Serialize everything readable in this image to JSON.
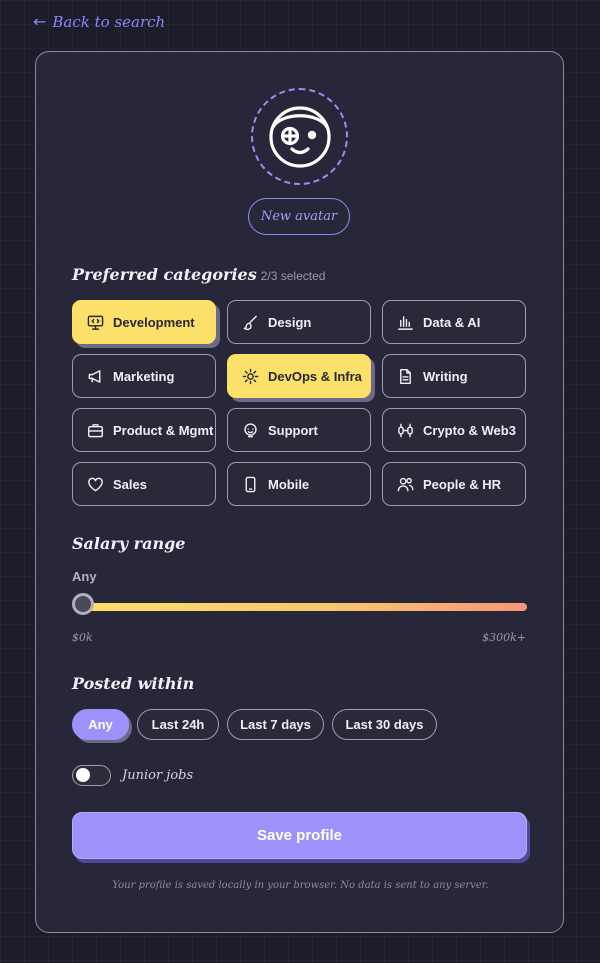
{
  "nav": {
    "back_arrow": "←",
    "back_label": "Back to search"
  },
  "avatar": {
    "icon": "face-with-headband-icon",
    "button_label": "New avatar"
  },
  "categories": {
    "title": "Preferred categories",
    "count_label": "2/3 selected",
    "items": [
      {
        "label": "Development",
        "icon": "monitor-code-icon",
        "selected": true
      },
      {
        "label": "Design",
        "icon": "brush-icon",
        "selected": false
      },
      {
        "label": "Data & AI",
        "icon": "bar-chart-icon",
        "selected": false
      },
      {
        "label": "Marketing",
        "icon": "megaphone-icon",
        "selected": false
      },
      {
        "label": "DevOps & Infra",
        "icon": "gear-icon",
        "selected": true
      },
      {
        "label": "Writing",
        "icon": "document-icon",
        "selected": false
      },
      {
        "label": "Product & Mgmt",
        "icon": "briefcase-icon",
        "selected": false
      },
      {
        "label": "Support",
        "icon": "headset-icon",
        "selected": false
      },
      {
        "label": "Crypto & Web3",
        "icon": "chain-icon",
        "selected": false
      },
      {
        "label": "Sales",
        "icon": "heart-icon",
        "selected": false
      },
      {
        "label": "Mobile",
        "icon": "phone-icon",
        "selected": false
      },
      {
        "label": "People & HR",
        "icon": "people-icon",
        "selected": false
      }
    ]
  },
  "salary": {
    "title": "Salary range",
    "value_label": "Any",
    "min_label": "$0k",
    "max_label": "$300k+",
    "current_fraction": 0
  },
  "posted": {
    "title": "Posted within",
    "options": [
      {
        "label": "Any",
        "active": true
      },
      {
        "label": "Last 24h",
        "active": false
      },
      {
        "label": "Last 7 days",
        "active": false
      },
      {
        "label": "Last 30 days",
        "active": false
      }
    ]
  },
  "junior": {
    "label": "Junior jobs",
    "enabled": false
  },
  "save": {
    "label": "Save profile"
  },
  "footer": {
    "note": "Your profile is saved locally in your browser. No data is sent to any server."
  },
  "colors": {
    "accent": "#9d92fa",
    "highlight": "#fbe06a",
    "card": "#282739",
    "background": "#1d1c2b"
  }
}
